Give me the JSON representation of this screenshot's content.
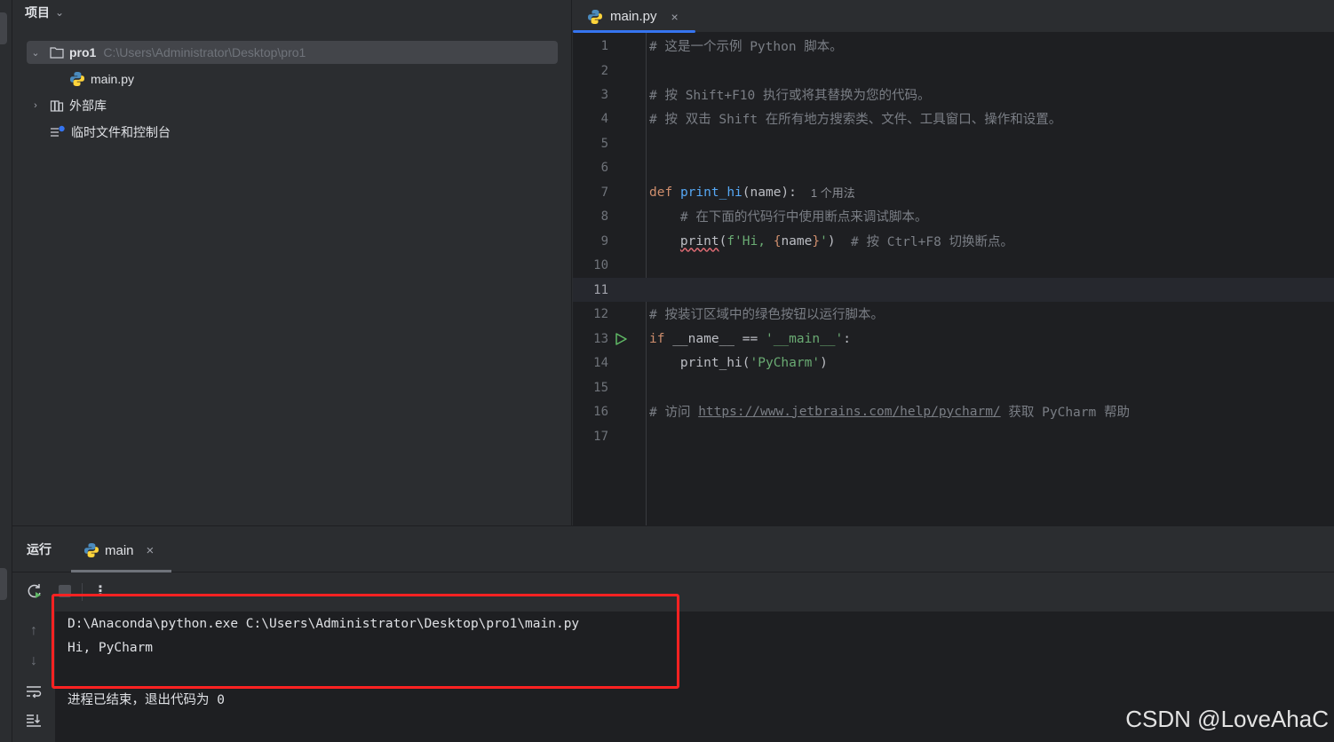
{
  "project_panel": {
    "title": "项目",
    "tree": [
      {
        "label": "pro1",
        "hint": "C:\\Users\\Administrator\\Desktop\\pro1",
        "icon": "folder-icon",
        "expanded": true
      },
      {
        "label": "main.py",
        "icon": "python-file-icon"
      },
      {
        "label": "外部库",
        "icon": "library-icon",
        "expanded": false
      },
      {
        "label": "临时文件和控制台",
        "icon": "scratches-icon"
      }
    ]
  },
  "editor": {
    "tab": {
      "label": "main.py",
      "close": "×"
    },
    "line_numbers": [
      "1",
      "2",
      "3",
      "4",
      "5",
      "6",
      "7",
      "8",
      "9",
      "10",
      "11",
      "12",
      "13",
      "14",
      "15",
      "16",
      "17"
    ],
    "current_line": "11",
    "code": {
      "l1": "# 这是一个示例 Python 脚本。",
      "l3": "# 按 Shift+F10 执行或将其替换为您的代码。",
      "l4": "# 按 双击 Shift 在所有地方搜索类、文件、工具窗口、操作和设置。",
      "l7_kw": "def",
      "l7_fn": "print_hi",
      "l7_rest": "(name):",
      "l7_hint": "1 个用法",
      "l8": "# 在下面的代码行中使用断点来调试脚本。",
      "l9_fn": "print",
      "l9_a": "(",
      "l9_str1": "f'Hi, ",
      "l9_br1": "{",
      "l9_var": "name",
      "l9_br2": "}",
      "l9_str2": "'",
      "l9_b": ")  ",
      "l9_cm": "# 按 Ctrl+F8 切换断点。",
      "l12": "# 按装订区域中的绿色按钮以运行脚本。",
      "l13_kw": "if",
      "l13_mid": " __name__ == ",
      "l13_str": "'__main__'",
      "l13_end": ":",
      "l14_a": "print_hi(",
      "l14_str": "'PyCharm'",
      "l14_b": ")",
      "l16_a": "# 访问 ",
      "l16_link": "https://www.jetbrains.com/help/pycharm/",
      "l16_b": " 获取 PyCharm 帮助"
    }
  },
  "run_panel": {
    "title": "运行",
    "tab": {
      "label": "main",
      "close": "×"
    },
    "console": [
      "D:\\Anaconda\\python.exe C:\\Users\\Administrator\\Desktop\\pro1\\main.py",
      "Hi, PyCharm",
      "进程已结束，退出代码为 0"
    ]
  },
  "watermark": "CSDN @LoveAhaC",
  "colors": {
    "accent": "#3574f0",
    "run_green": "#5fb865",
    "annotation": "#ff2222"
  }
}
